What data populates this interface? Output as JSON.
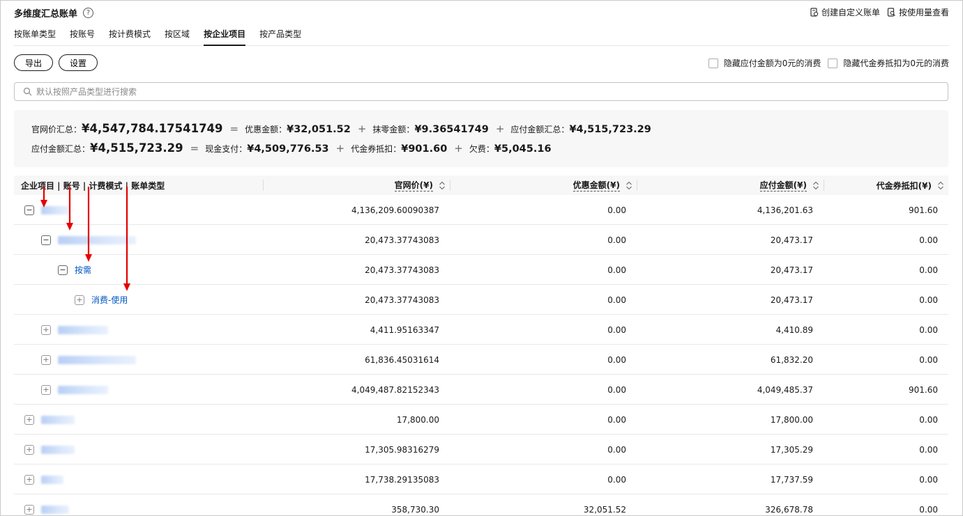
{
  "header": {
    "title": "多维度汇总账单",
    "help_icon": "?",
    "links": {
      "custom_bill": "创建自定义账单",
      "by_usage": "按使用量查看"
    }
  },
  "tabs": [
    "按账单类型",
    "按账号",
    "按计费模式",
    "按区域",
    "按企业项目",
    "按产品类型"
  ],
  "active_tab": "按企业项目",
  "toolbar": {
    "export": "导出",
    "settings": "设置"
  },
  "filters": {
    "hide_zero_payable": "隐藏应付金额为0元的消费",
    "hide_zero_coupon": "隐藏代金券抵扣为0元的消费"
  },
  "search": {
    "placeholder": "默认按照产品类型进行搜索"
  },
  "summary": {
    "line1": {
      "list_price_label": "官网价汇总：",
      "list_price": "¥4,547,784.17541749",
      "op1": "=",
      "discount_label": "优惠金额：",
      "discount": "¥32,051.52",
      "op2": "+",
      "rounding_label": "抹零金额：",
      "rounding": "¥9.36541749",
      "op3": "+",
      "payable_label": "应付金额汇总：",
      "payable": "¥4,515,723.29"
    },
    "line2": {
      "payable_label": "应付金额汇总：",
      "payable": "¥4,515,723.29",
      "op1": "=",
      "cash_label": "现金支付：",
      "cash": "¥4,509,776.53",
      "op2": "+",
      "coupon_label": "代金券抵扣：",
      "coupon": "¥901.60",
      "op3": "+",
      "owed_label": "欠费：",
      "owed": "¥5,045.16"
    }
  },
  "table": {
    "headers": {
      "dimension": "企业项目 | 账号 | 计费模式 | 账单类型",
      "list_price": "官网价(¥)",
      "discount": "优惠金额(¥)",
      "payable": "应付金额(¥)",
      "coupon": "代金券抵扣(¥)"
    },
    "rows": [
      {
        "label": "",
        "list_price": "4,136,209.60090387",
        "discount": "0.00",
        "payable": "4,136,201.63",
        "coupon": "901.60"
      },
      {
        "label": "",
        "list_price": "20,473.37743083",
        "discount": "0.00",
        "payable": "20,473.17",
        "coupon": "0.00"
      },
      {
        "label": "按需",
        "list_price": "20,473.37743083",
        "discount": "0.00",
        "payable": "20,473.17",
        "coupon": "0.00"
      },
      {
        "label": "消费-使用",
        "list_price": "20,473.37743083",
        "discount": "0.00",
        "payable": "20,473.17",
        "coupon": "0.00"
      },
      {
        "label": "",
        "list_price": "4,411.95163347",
        "discount": "0.00",
        "payable": "4,410.89",
        "coupon": "0.00"
      },
      {
        "label": "",
        "list_price": "61,836.45031614",
        "discount": "0.00",
        "payable": "61,832.20",
        "coupon": "0.00"
      },
      {
        "label": "",
        "list_price": "4,049,487.82152343",
        "discount": "0.00",
        "payable": "4,049,485.37",
        "coupon": "901.60"
      },
      {
        "label": "",
        "list_price": "17,800.00",
        "discount": "0.00",
        "payable": "17,800.00",
        "coupon": "0.00"
      },
      {
        "label": "",
        "list_price": "17,305.98316279",
        "discount": "0.00",
        "payable": "17,305.29",
        "coupon": "0.00"
      },
      {
        "label": "",
        "list_price": "17,738.29135083",
        "discount": "0.00",
        "payable": "17,737.59",
        "coupon": "0.00"
      },
      {
        "label": "",
        "list_price": "358,730.30",
        "discount": "32,051.52",
        "payable": "326,678.78",
        "coupon": "0.00"
      }
    ]
  },
  "colors": {
    "link": "#0057c3",
    "annotation_arrow": "#e60000",
    "summary_bg": "#f7f7f7"
  },
  "icons": [
    "help-icon",
    "custom-bill-icon",
    "usage-search-icon",
    "search-icon",
    "sort-icon",
    "collapse-icon",
    "expand-icon",
    "annotation-arrow"
  ]
}
